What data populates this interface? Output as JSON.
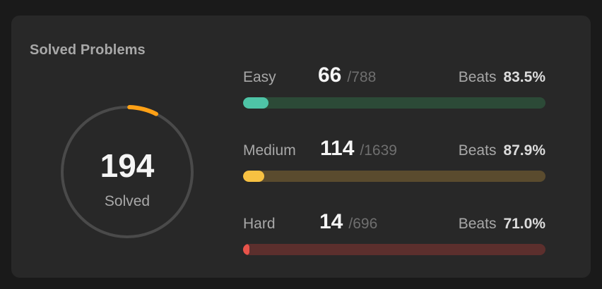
{
  "card": {
    "title": "Solved Problems"
  },
  "summary": {
    "solved": "194",
    "label": "Solved",
    "solved_fraction": 0.068,
    "colors": {
      "ring_track": "#4a4a4a",
      "ring_progress": "#ffa116"
    }
  },
  "difficulties": [
    {
      "name": "Easy",
      "solved": "66",
      "total": "/788",
      "beats_label": "Beats",
      "beats": "83.5%",
      "progress": 0.0838,
      "colors": {
        "fill": "#4ec4a6",
        "track": "#2c4a37"
      }
    },
    {
      "name": "Medium",
      "solved": "114",
      "total": "/1639",
      "beats_label": "Beats",
      "beats": "87.9%",
      "progress": 0.0696,
      "colors": {
        "fill": "#f7c142",
        "track": "#5a4b2e"
      }
    },
    {
      "name": "Hard",
      "solved": "14",
      "total": "/696",
      "beats_label": "Beats",
      "beats": "71.0%",
      "progress": 0.0201,
      "colors": {
        "fill": "#e8534a",
        "track": "#5c2f2d"
      }
    }
  ]
}
